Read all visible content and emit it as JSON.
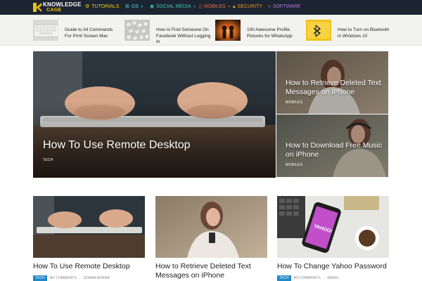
{
  "colors": {
    "nav_bg": "#1c2431",
    "tutorials": "#f5d300",
    "os": "#5dd0d6",
    "social": "#45c5ae",
    "mobiles": "#ef6a3b",
    "security": "#ef9c14",
    "software": "#b57ae0",
    "tag_bg": "#1e88c9"
  },
  "brand": {
    "line1": "KNOWLEDGE",
    "line2": "CAGE"
  },
  "nav": [
    {
      "label": "TUTORIALS",
      "icon": "gear-icon"
    },
    {
      "label": "OS",
      "icon": "windows-icon"
    },
    {
      "label": "SOCIAL MEDIA",
      "icon": "globe-icon"
    },
    {
      "label": "MOBILES",
      "icon": "phone-icon"
    },
    {
      "label": "SECURITY",
      "icon": "lock-icon"
    },
    {
      "label": "SOFTWARE",
      "icon": "code-icon"
    }
  ],
  "trending": [
    {
      "title": "Guide to All Commands For Print Screen Mac"
    },
    {
      "title": "How to Find Someone On Facebook Without Logging In"
    },
    {
      "title": "100 Awesome Profile Pictures for WhatsApp"
    },
    {
      "title": "How to Turn on Bluetooth in Windows 10"
    }
  ],
  "hero": {
    "main": {
      "title": "How To Use Remote Desktop",
      "category": "TECH"
    },
    "side": [
      {
        "title": "How to Retrieve Deleted Text Messages on iPhone",
        "category": "MOBILES"
      },
      {
        "title": "How to Download Free Music on iPhone",
        "category": "MOBILES"
      }
    ]
  },
  "cards": [
    {
      "title": "How To Use Remote Desktop",
      "tag": "TECH",
      "comments": "NO COMMENTS",
      "author": "SONAM ADRAW"
    },
    {
      "title": "How to Retrieve Deleted Text Messages on iPhone",
      "tag": "",
      "comments": "",
      "author": ""
    },
    {
      "title": "How To Change Yahoo Password",
      "tag": "TECH",
      "comments": "NO COMMENTS",
      "author": "RAHUL"
    }
  ]
}
